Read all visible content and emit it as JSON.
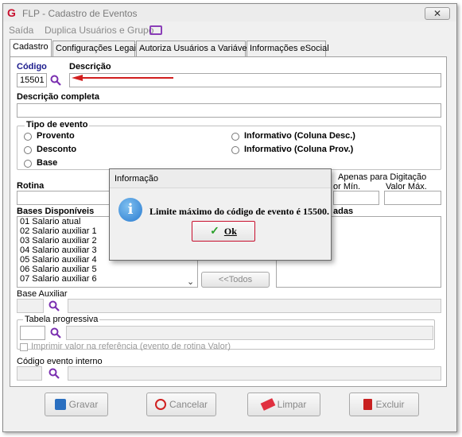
{
  "window": {
    "title": "FLP - Cadastro de Eventos",
    "close_glyph": "✕"
  },
  "menu": {
    "items": [
      "Saída",
      "Duplica Usuários e Grupo"
    ]
  },
  "tabs": [
    "Cadastro",
    "Configurações Legais",
    "Autoriza Usuários a Variáveis",
    "Informações eSocial"
  ],
  "form": {
    "codigo_label": "Código",
    "codigo_value": "15501",
    "descricao_label": "Descrição",
    "descricao_value": "",
    "descricao_completa_label": "Descrição completa",
    "tipo_evento_label": "Tipo de evento",
    "tipo_options": [
      "Provento",
      "Desconto",
      "Base",
      "Informativo (Coluna Desc.)",
      "Informativo (Coluna Prov.)"
    ],
    "rotina_label": "Rotina",
    "apenas_digitacao_label": "Apenas para Digitação",
    "valor_min_label": "or Mín.",
    "valor_max_label": "Valor Máx.",
    "bases_disponiveis_label": "Bases Disponíveis",
    "bases_selecionadas_label": "adas",
    "bases": [
      "01 Salario atual",
      "02 Salario auxiliar 1",
      "03 Salario auxiliar 2",
      "04 Salario auxiliar 3",
      "05 Salario auxiliar 4",
      "06 Salario auxiliar 5",
      "07 Salario auxiliar 6"
    ],
    "todos_button": "<<Todos",
    "base_auxiliar_label": "Base Auxiliar",
    "tabela_progressiva_label": "Tabela progressiva",
    "imprimir_label": "Imprimir valor na referência (evento de rotina Valor)",
    "codigo_evento_interno_label": "Código evento interno"
  },
  "buttons": {
    "gravar": "Gravar",
    "cancelar": "Cancelar",
    "limpar": "Limpar",
    "excluir": "Excluir"
  },
  "dialog": {
    "title": "Informação",
    "message": "Limite máximo do código de evento é 15500.",
    "ok": "Ok"
  },
  "colors": {
    "accent": "#c8102e",
    "arrow": "#d21f1f",
    "search_icon": "#7a2fb0"
  }
}
